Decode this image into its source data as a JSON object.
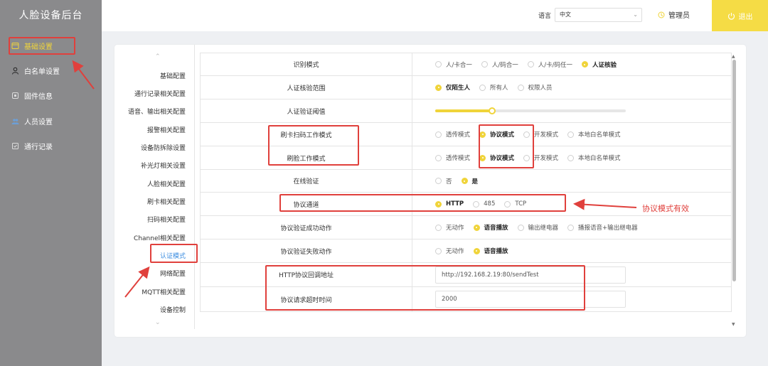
{
  "app": {
    "title": "人脸设备后台"
  },
  "sidebar": {
    "items": [
      {
        "label": "基础设置",
        "icon": "settings-card-icon",
        "active": true
      },
      {
        "label": "白名单设置",
        "icon": "user-icon",
        "active": false
      },
      {
        "label": "固件信息",
        "icon": "firmware-icon",
        "active": false
      },
      {
        "label": "人员设置",
        "icon": "people-icon",
        "active": false
      },
      {
        "label": "通行记录",
        "icon": "record-icon",
        "active": false
      }
    ]
  },
  "header": {
    "language_label": "语言",
    "language_value": "中文",
    "admin_label": "管理员",
    "logout_label": "退出"
  },
  "settings_nav": {
    "items": [
      {
        "label": "基础配置"
      },
      {
        "label": "通行记录相关配置"
      },
      {
        "label": "语音、输出相关配置"
      },
      {
        "label": "报警相关配置"
      },
      {
        "label": "设备防拆除设置"
      },
      {
        "label": "补光灯相关设置"
      },
      {
        "label": "人脸相关配置"
      },
      {
        "label": "刷卡相关配置"
      },
      {
        "label": "扫码相关配置"
      },
      {
        "label": "Channel相关配置"
      },
      {
        "label": "认证模式",
        "active": true
      },
      {
        "label": "网络配置"
      },
      {
        "label": "MQTT相关配置"
      },
      {
        "label": "设备控制"
      }
    ]
  },
  "form": {
    "rows": [
      {
        "label": "识别模式",
        "type": "radio",
        "options": [
          "人/卡合一",
          "人/码合一",
          "人/卡/码任一",
          "人证核验"
        ],
        "selected": 3
      },
      {
        "label": "人证核验范围",
        "type": "radio",
        "options": [
          "仅陌生人",
          "所有人",
          "权限人员"
        ],
        "selected": 0
      },
      {
        "label": "人证验证阈值",
        "type": "slider",
        "value": 0.3
      },
      {
        "label": "刷卡扫码工作模式",
        "type": "radio",
        "options": [
          "透传模式",
          "协议模式",
          "开发模式",
          "本地白名单模式"
        ],
        "selected": 1
      },
      {
        "label": "刷脸工作模式",
        "type": "radio",
        "options": [
          "透传模式",
          "协议模式",
          "开发模式",
          "本地白名单模式"
        ],
        "selected": 1
      },
      {
        "label": "在线验证",
        "type": "radio",
        "options": [
          "否",
          "是"
        ],
        "selected": 1
      },
      {
        "label": "协议通道",
        "type": "radio",
        "options": [
          "HTTP",
          "485",
          "TCP"
        ],
        "selected": 0
      },
      {
        "label": "协议验证成功动作",
        "type": "radio",
        "options": [
          "无动作",
          "语音播放",
          "输出继电器",
          "播报语音+输出继电器"
        ],
        "selected": 1
      },
      {
        "label": "协议验证失败动作",
        "type": "radio",
        "options": [
          "无动作",
          "语音播放"
        ],
        "selected": 1
      },
      {
        "label": "HTTP协议回调地址",
        "type": "input",
        "value": "http://192.168.2.19:80/sendTest"
      },
      {
        "label": "协议请求超时时间",
        "type": "input",
        "value": "2000"
      }
    ]
  },
  "annotation": {
    "note": "协议模式有效",
    "color": "#e0403c"
  },
  "colors": {
    "accent": "#f0d43a",
    "sidebar": "#8a8a8c",
    "link": "#3b8de0"
  }
}
